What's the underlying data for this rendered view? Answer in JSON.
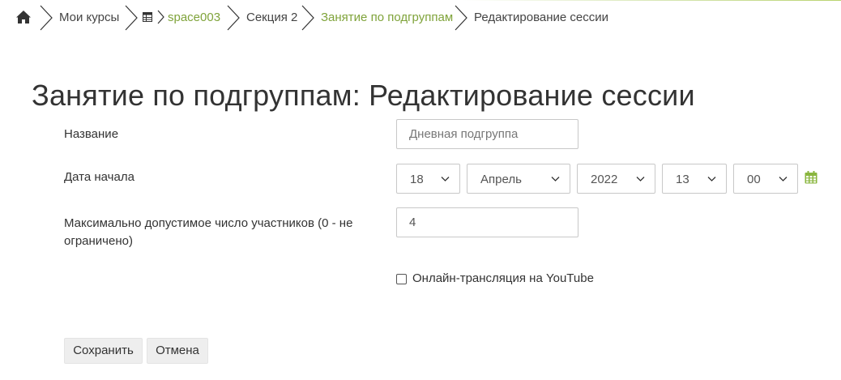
{
  "breadcrumb": {
    "items": [
      {
        "label": "Мои курсы"
      },
      {
        "label": "space003"
      },
      {
        "label": "Секция 2"
      },
      {
        "label": "Занятие по подгруппам"
      },
      {
        "label": "Редактирование сессии"
      }
    ]
  },
  "page": {
    "title": "Занятие по подгруппам: Редактирование сессии"
  },
  "form": {
    "name_label": "Название",
    "name_value": "Дневная подгруппа",
    "start_label": "Дата начала",
    "day": "18",
    "month": "Апрель",
    "year": "2022",
    "hour": "13",
    "minute": "00",
    "max_label": "Максимально допустимое число участников (0 - не ограничено)",
    "max_value": "4",
    "youtube_label": "Онлайн-трансляция на YouTube",
    "youtube_checked": false
  },
  "buttons": {
    "save": "Сохранить",
    "cancel": "Отмена"
  },
  "colors": {
    "accent": "#7fa33a",
    "calendar": "#8ab63f"
  },
  "icons": [
    "home-icon",
    "chevron-right-icon",
    "table-icon",
    "chevron-down-icon",
    "calendar-icon"
  ]
}
